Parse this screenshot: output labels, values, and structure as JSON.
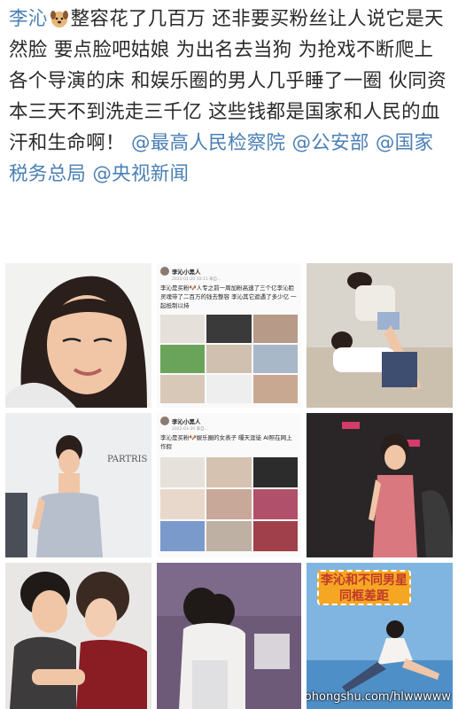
{
  "post": {
    "author": "李沁",
    "emoji": "dog-face-icon",
    "text_main": "整容花了几百万 还非要买粉丝让人说它是天然脸 要点脸吧姑娘 为出名去当狗 为抢戏不断爬上各个导演的床 和娱乐圈的男人几乎睡了一圈 伙同资本三天不到洗走三千亿 这些钱都是国家和人民的血汗和生命啊！",
    "mentions": [
      "@最高人民检察院",
      "@公安部",
      "@国家税务总局",
      "@央视新闻"
    ]
  },
  "screenshot_1": {
    "name": "李沁小黑人",
    "time": "2022-01-20 10:11 来自...",
    "text": "李沁是买粉🐶人专之前一周加粉高速了三个亿李沁脸灵魂带了二百万的钱去整容 李沁其它遮遇了多少亿 一起抵制以持"
  },
  "screenshot_2": {
    "name": "李沁小黑人",
    "time": "2022-01-20 来自...",
    "text": "李沁是买粉🐶娱乐圈的女表子 曝天涯徒 AI照在网上作假"
  },
  "banner": {
    "line1": "李沁和不同男星",
    "line2": "同框差距"
  },
  "watermark": "tvxiaohongshu.com/hlwwwww",
  "colors": {
    "text": "#2a2a2a",
    "link": "#4a7fb5",
    "banner_bg": "#f5a623",
    "banner_text": "#c0392b"
  }
}
